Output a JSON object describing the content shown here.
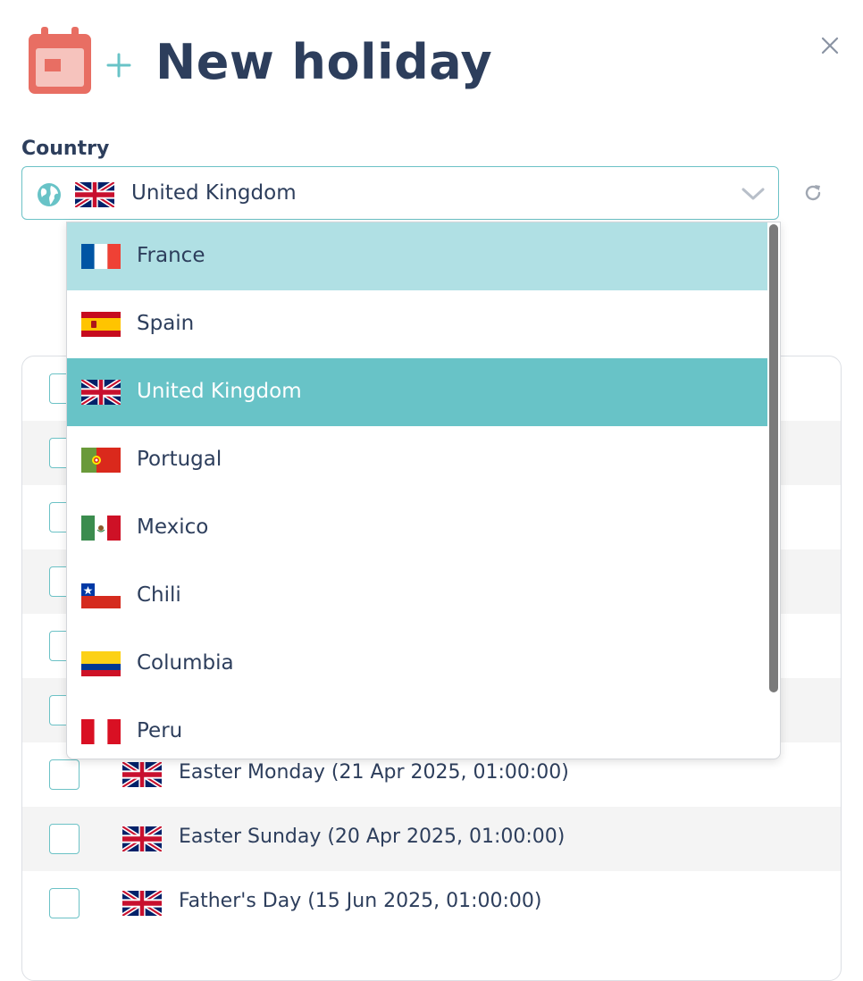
{
  "header": {
    "title": "New holiday"
  },
  "country": {
    "label": "Country",
    "selected": "United Kingdom",
    "selected_flag": "uk"
  },
  "dropdown": {
    "options": [
      {
        "label": "France",
        "flag": "fr",
        "state": "hover"
      },
      {
        "label": "Spain",
        "flag": "es",
        "state": ""
      },
      {
        "label": "United Kingdom",
        "flag": "uk",
        "state": "selected"
      },
      {
        "label": "Portugal",
        "flag": "pt",
        "state": ""
      },
      {
        "label": "Mexico",
        "flag": "mx",
        "state": ""
      },
      {
        "label": "Chili",
        "flag": "cl",
        "state": ""
      },
      {
        "label": "Columbia",
        "flag": "co",
        "state": ""
      },
      {
        "label": "Peru",
        "flag": "pe",
        "state": ""
      }
    ]
  },
  "holidays": {
    "rows": [
      {
        "text": "Easter Monday (21 Apr 2025, 01:00:00)"
      },
      {
        "text": "Easter Sunday (20 Apr 2025, 01:00:00)"
      },
      {
        "text": "Father's Day (15 Jun 2025, 01:00:00)"
      }
    ]
  },
  "colors": {
    "accent": "#68c3c7",
    "hover": "#b0e0e4",
    "text": "#2d3e5c",
    "calendar": "#e86e63"
  },
  "icons": {
    "header": "calendar-icon",
    "plus": "plus-icon",
    "close": "close-icon",
    "globe": "globe-icon",
    "chevron": "chevron-down-icon",
    "refresh": "refresh-icon"
  }
}
